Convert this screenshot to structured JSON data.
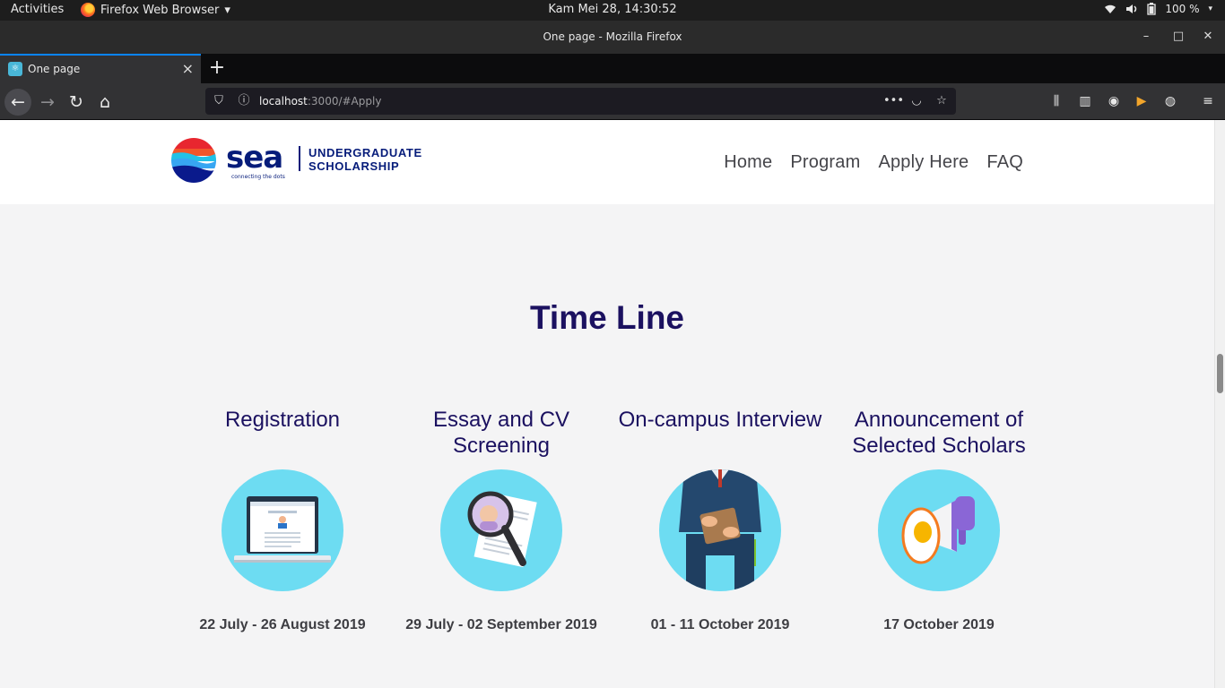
{
  "system_bar": {
    "activities": "Activities",
    "app_name": "Firefox Web Browser",
    "clock": "Kam Mei 28, 14:30:52",
    "battery": "100 %"
  },
  "window": {
    "title": "One page - Mozilla Firefox"
  },
  "tabs": [
    {
      "label": "One page"
    }
  ],
  "urlbar": {
    "host": "localhost",
    "rest": ":3000/#Apply"
  },
  "site": {
    "logo": {
      "wordmark": "sea",
      "tagline": "connecting the dots",
      "line1": "UNDERGRADUATE",
      "line2": "SCHOLARSHIP"
    },
    "nav": [
      "Home",
      "Program",
      "Apply Here",
      "FAQ"
    ]
  },
  "timeline": {
    "heading": "Time Line",
    "steps": [
      {
        "title": "Registration",
        "date": "22 July - 26 August 2019",
        "icon": "laptop-registration-icon"
      },
      {
        "title": "Essay and CV Screening",
        "date": "29 July - 02 September 2019",
        "icon": "magnifier-cv-icon"
      },
      {
        "title": "On-campus Interview",
        "date": "01 - 11 October 2019",
        "icon": "interviewee-icon"
      },
      {
        "title": "Announcement of Selected Scholars",
        "date": "17 October 2019",
        "icon": "megaphone-icon"
      }
    ]
  }
}
